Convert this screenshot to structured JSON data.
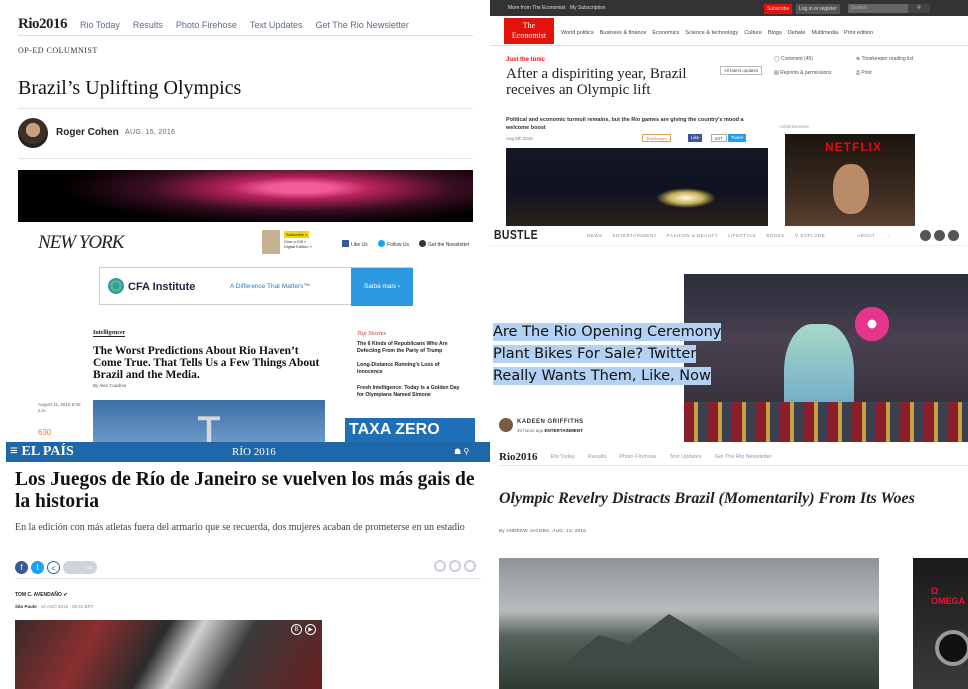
{
  "nyt1": {
    "logo": "Rio2016",
    "nav": [
      "Rio Today",
      "Results",
      "Photo Firehose",
      "Text Updates",
      "Get The Rio Newsletter"
    ],
    "kicker": "OP-ED COLUMNIST",
    "title": "Brazil’s Uplifting Olympics",
    "author": "Roger Cohen",
    "date": "AUG. 15, 2016"
  },
  "economist": {
    "topbar": [
      "More from The Economist",
      "My Subscription"
    ],
    "subscribe": "Subscribe",
    "login": "Log in or register",
    "search_placeholder": "Search",
    "logo_line1": "The",
    "logo_line2": "Economist",
    "nav": [
      "World politics",
      "Business & finance",
      "Economics",
      "Science & technology",
      "Culture",
      "Blogs",
      "Debate",
      "Multimedia",
      "Print edition"
    ],
    "fly_title": "Just the tonic",
    "headline": "After a dispiriting year, Brazil receives an Olympic lift",
    "latest": "All latest updates",
    "side": [
      "Comment (45)",
      "Timekeeper reading list",
      "Reprints & permissions",
      "Print"
    ],
    "rubric": "Political and economic turmoil remains, but the Rio games are giving the country's mood a welcome boost",
    "date": "Aug 6th 2016",
    "timekeeper": "Timekeeper",
    "like": "Like",
    "count": "247",
    "tweet": "Tweet",
    "ad_label": "Advertisement",
    "ad_brand": "NETFLIX"
  },
  "nymag": {
    "logo": "NEW YORK",
    "subscribe_btn": "Subscribe »",
    "subscribe_text": "Give a Gift » Digital Edition »",
    "social": [
      "Like Us",
      "Follow Us",
      "Get the Newsletter"
    ],
    "ad_brand": "CFA Institute",
    "ad_tagline": "A Difference That Matters™",
    "ad_button": "Saiba mais ›",
    "section": "Intelligencer",
    "headline": "The Worst Predictions About Rio Haven’t Come True. That Tells Us a Few Things About Brazil and the Media.",
    "byline": "By Alex Cuadros",
    "dateline": "August 11, 2016 8:00 a.m.",
    "count": "630",
    "top_stories_title": "Top Stories",
    "top_stories": [
      "The 6 Kinds of Republicans Who Are Defecting From the Party of Trump",
      "Long-Distance Running’s Loss of Innocence",
      "Fresh Intelligence: Today Is a Golden Day for Olympians Named Simone"
    ],
    "tax_ad": "TAXA ZERO"
  },
  "bustle": {
    "logo": "BUSTLE",
    "nav": [
      "NEWS",
      "ENTERTAINMENT",
      "FASHION & BEAUTY",
      "LIFESTYLE",
      "BOOKS",
      "EXPLORE",
      "ABOUT"
    ],
    "title": "Are The Rio Opening Ceremony Plant Bikes For Sale? Twitter Really Wants Them, Like, Now",
    "author": "KADEEN GRIFFITHS",
    "time": "20 hours ago",
    "section": "ENTERTAINMENT"
  },
  "elpais": {
    "logo": "EL PAÍS",
    "section": "RÍO 2016",
    "title": "Los Juegos de Río de Janeiro se vuelven los más gais de la historia",
    "subtitle": "En la edición con más atletas fuera del armario que se recuerda, dos mujeres acaban de prometerse en un estadio",
    "share_count": "138",
    "author": "TOM C. AVENDAÑO",
    "location": "São Paulo",
    "date": "10 AGO 2016 - 00:41 BRT"
  },
  "nyt2": {
    "logo": "Rio2016",
    "nav": [
      "Rio Today",
      "Results",
      "Photo Firehose",
      "Text Updates",
      "Get The Rio Newsletter"
    ],
    "title": "Olympic Revelry Distracts Brazil (Momentarily) From Its Woes",
    "byline": "By ANDREW JACOBS",
    "date": "AUG. 13, 2016",
    "ad_brand": "OMEGA"
  }
}
